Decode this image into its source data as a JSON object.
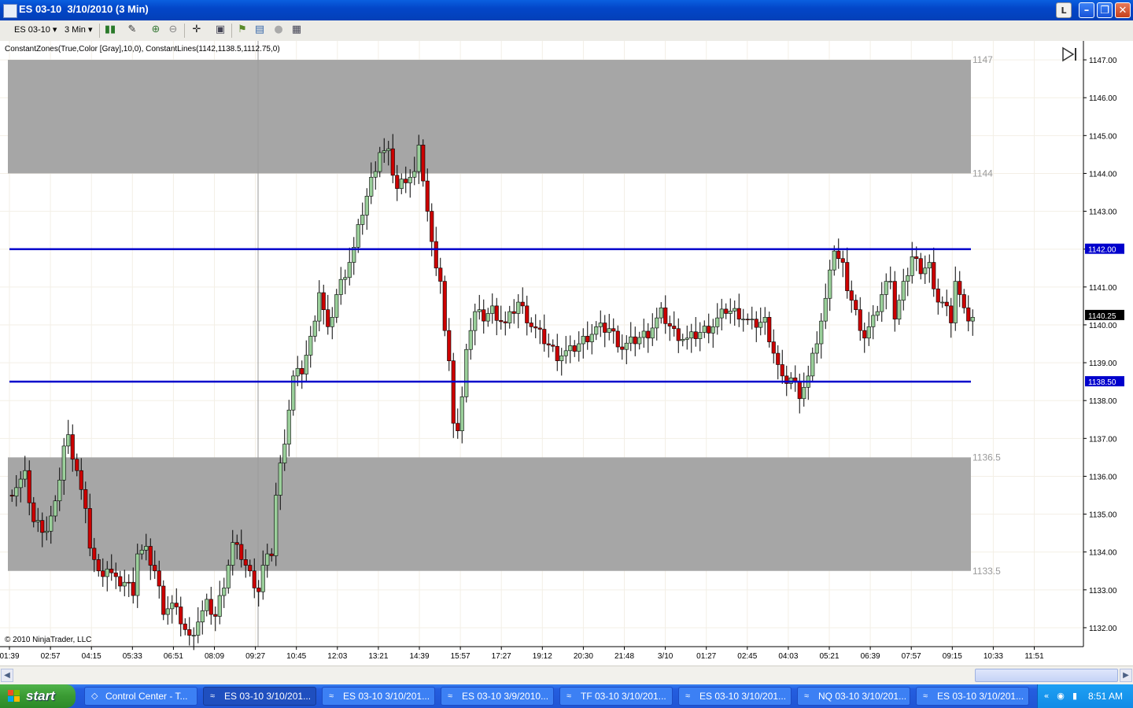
{
  "window": {
    "title": "ES 03-10  3/10/2010 (3 Min)",
    "buttons": {
      "l": "L",
      "minimize": "–",
      "restore": "❐",
      "close": "✕"
    }
  },
  "toolbar": {
    "instrument": "ES 03-10",
    "interval": "3 Min",
    "icons": [
      "candles-icon",
      "pencil-icon",
      "zoom-in-icon",
      "zoom-out-icon",
      "crosshair-icon",
      "properties-icon",
      "indicator-icon",
      "strategy-icon",
      "stop-icon",
      "data-box-icon"
    ]
  },
  "chart": {
    "indicator_label": "ConstantZones(True,Color [Gray],10,0), ConstantLines(1142,1138.5,1112.75,0)",
    "copyright": "© 2010 NinjaTrader, LLC",
    "current_price": "1140.25",
    "colors": {
      "up": "#9acf9a",
      "down": "#cc0000",
      "zone": "#a6a6a6",
      "line": "#0000cc",
      "grid": "#f3efe6"
    }
  },
  "chart_data": {
    "type": "candlestick",
    "y_ticks": [
      "1132.00",
      "1133.00",
      "1134.00",
      "1135.00",
      "1136.00",
      "1137.00",
      "1138.00",
      "1139.00",
      "1140.00",
      "1141.00",
      "1142.00",
      "1143.00",
      "1144.00",
      "1145.00",
      "1146.00",
      "1147.00"
    ],
    "ylim": [
      1131.5,
      1147.5
    ],
    "x_ticks": [
      "01:39",
      "02:57",
      "04:15",
      "05:33",
      "06:51",
      "08:09",
      "09:27",
      "10:45",
      "12:03",
      "13:21",
      "14:39",
      "15:57",
      "17:27",
      "19:12",
      "20:30",
      "21:48",
      "3/10",
      "01:27",
      "02:45",
      "04:03",
      "05:21",
      "06:39",
      "07:57",
      "09:15",
      "10:33",
      "11:51"
    ],
    "zones": [
      {
        "from": 1144,
        "to": 1147,
        "label_top": "1147",
        "label_bottom": "1144"
      },
      {
        "from": 1133.5,
        "to": 1136.5,
        "label_top": "1136.5",
        "label_bottom": "1133.5"
      }
    ],
    "lines": [
      {
        "value": 1142,
        "label": "1142.00"
      },
      {
        "value": 1138.5,
        "label": "1138.50"
      }
    ],
    "last_price": 1140.25,
    "path": [
      [
        0,
        1135.5
      ],
      [
        4,
        1136
      ],
      [
        6,
        1134.8
      ],
      [
        9,
        1134.6
      ],
      [
        11,
        1135.2
      ],
      [
        13,
        1136.8
      ],
      [
        14,
        1137
      ],
      [
        16,
        1136.2
      ],
      [
        18,
        1135
      ],
      [
        19,
        1134.2
      ],
      [
        21,
        1133.4
      ],
      [
        23,
        1133.6
      ],
      [
        25,
        1133.2
      ],
      [
        27,
        1133.2
      ],
      [
        29,
        1133
      ],
      [
        30,
        1134
      ],
      [
        32,
        1134
      ],
      [
        34,
        1133.5
      ],
      [
        36,
        1132.5
      ],
      [
        38,
        1132.6
      ],
      [
        40,
        1132.2
      ],
      [
        42,
        1131.7
      ],
      [
        44,
        1132.2
      ],
      [
        46,
        1132.6
      ],
      [
        48,
        1132.3
      ],
      [
        50,
        1133.2
      ],
      [
        52,
        1134.2
      ],
      [
        54,
        1133.9
      ],
      [
        56,
        1133.4
      ],
      [
        58,
        1133
      ],
      [
        59,
        1133.6
      ],
      [
        61,
        1134
      ],
      [
        62,
        1135.5
      ],
      [
        64,
        1137
      ],
      [
        66,
        1138.6
      ],
      [
        68,
        1138.8
      ],
      [
        70,
        1139.6
      ],
      [
        72,
        1140.9
      ],
      [
        74,
        1139.8
      ],
      [
        76,
        1140.8
      ],
      [
        78,
        1141.4
      ],
      [
        80,
        1142
      ],
      [
        82,
        1143
      ],
      [
        84,
        1143.8
      ],
      [
        86,
        1144.6
      ],
      [
        88,
        1144.5
      ],
      [
        90,
        1143.6
      ],
      [
        92,
        1143.9
      ],
      [
        94,
        1144
      ],
      [
        95,
        1144.6
      ],
      [
        96,
        1143.9
      ],
      [
        98,
        1142.1
      ],
      [
        100,
        1141.2
      ],
      [
        101,
        1139.8
      ],
      [
        102,
        1138.9
      ],
      [
        103,
        1137.5
      ],
      [
        104,
        1137.2
      ],
      [
        105,
        1138
      ],
      [
        106,
        1139.5
      ],
      [
        108,
        1140.3
      ],
      [
        110,
        1140.2
      ],
      [
        112,
        1140.4
      ],
      [
        115,
        1140
      ],
      [
        118,
        1140.6
      ],
      [
        121,
        1140
      ],
      [
        124,
        1139.6
      ],
      [
        127,
        1139.2
      ],
      [
        130,
        1139.3
      ],
      [
        133,
        1139.6
      ],
      [
        136,
        1139.9
      ],
      [
        139,
        1139.9
      ],
      [
        142,
        1139.4
      ],
      [
        145,
        1139.6
      ],
      [
        148,
        1139.8
      ],
      [
        151,
        1140.3
      ],
      [
        154,
        1139.8
      ],
      [
        157,
        1139.6
      ],
      [
        160,
        1139.8
      ],
      [
        163,
        1140
      ],
      [
        166,
        1140.4
      ],
      [
        169,
        1140.3
      ],
      [
        172,
        1140
      ],
      [
        175,
        1140.1
      ],
      [
        177,
        1139.3
      ],
      [
        179,
        1138.5
      ],
      [
        181,
        1138.6
      ],
      [
        183,
        1138.2
      ],
      [
        185,
        1138.6
      ],
      [
        187,
        1139.6
      ],
      [
        189,
        1140.6
      ],
      [
        190,
        1141.6
      ],
      [
        191,
        1142
      ],
      [
        192,
        1141.7
      ],
      [
        193,
        1141.5
      ],
      [
        194,
        1141
      ],
      [
        196,
        1140.3
      ],
      [
        198,
        1139.7
      ],
      [
        200,
        1140.1
      ],
      [
        202,
        1140.8
      ],
      [
        204,
        1141.3
      ],
      [
        205,
        1140.2
      ],
      [
        207,
        1141
      ],
      [
        209,
        1141.8
      ],
      [
        211,
        1141.5
      ],
      [
        213,
        1141.6
      ],
      [
        214,
        1140.8
      ],
      [
        216,
        1140.6
      ],
      [
        218,
        1140.2
      ],
      [
        219,
        1141.2
      ],
      [
        221,
        1140.3
      ],
      [
        222,
        1140.2
      ]
    ]
  },
  "scrollbar": {
    "left_arrow": "◀",
    "right_arrow": "▶"
  },
  "taskbar": {
    "start_label": "start",
    "tasks": [
      {
        "label": "Control Center - T...",
        "icon": "◇"
      },
      {
        "label": "ES 03-10  3/10/201...",
        "icon": "≈"
      },
      {
        "label": "ES 03-10  3/10/201...",
        "icon": "≈"
      },
      {
        "label": "ES 03-10  3/9/2010...",
        "icon": "≈"
      },
      {
        "label": "TF 03-10  3/10/201...",
        "icon": "≈"
      },
      {
        "label": "ES 03-10  3/10/201...",
        "icon": "≈"
      },
      {
        "label": "NQ 03-10  3/10/201...",
        "icon": "≈"
      },
      {
        "label": "ES 03-10  3/10/201...",
        "icon": "≈"
      }
    ],
    "clock": "8:51 AM"
  }
}
